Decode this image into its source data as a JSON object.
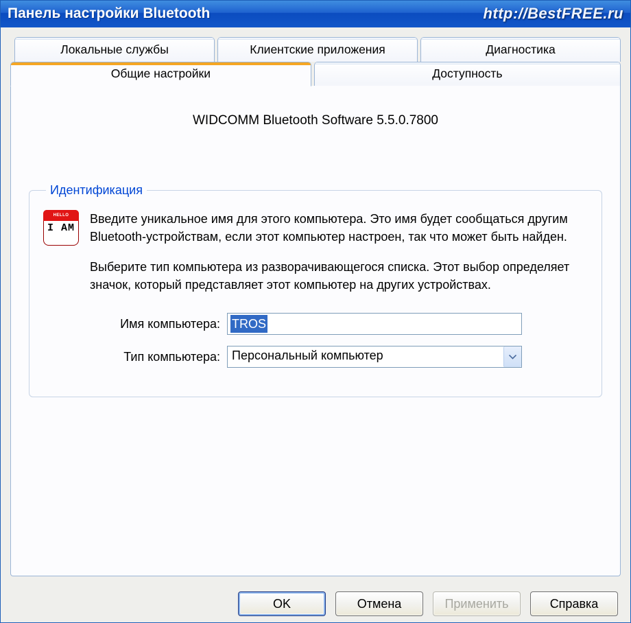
{
  "titlebar": {
    "title": "Панель настройки Bluetooth",
    "watermark": "http://BestFREE.ru"
  },
  "tabs": {
    "row1": [
      {
        "label": "Локальные службы"
      },
      {
        "label": "Клиентские приложения"
      },
      {
        "label": "Диагностика"
      }
    ],
    "row2": [
      {
        "label": "Общие настройки",
        "active": true
      },
      {
        "label": "Доступность"
      }
    ]
  },
  "panel": {
    "software_title": "WIDCOMM Bluetooth Software 5.5.0.7800",
    "group_legend": "Идентификация",
    "icon": {
      "header": "HELLO",
      "body": "I AM"
    },
    "desc1": "Введите уникальное имя для этого компьютера.  Это имя будет сообщаться другим Bluetooth-устройствам, если этот компьютер настроен, так что может быть найден.",
    "desc2": "Выберите тип компьютера из разворачивающегося списка.  Этот выбор определяет значок, который представляет этот компьютер на других устройствах.",
    "fields": {
      "name_label": "Имя компьютера:",
      "name_value": "TROS",
      "type_label": "Тип компьютера:",
      "type_value": "Персональный компьютер"
    }
  },
  "buttons": {
    "ok": "OK",
    "cancel": "Отмена",
    "apply": "Применить",
    "help": "Справка"
  }
}
